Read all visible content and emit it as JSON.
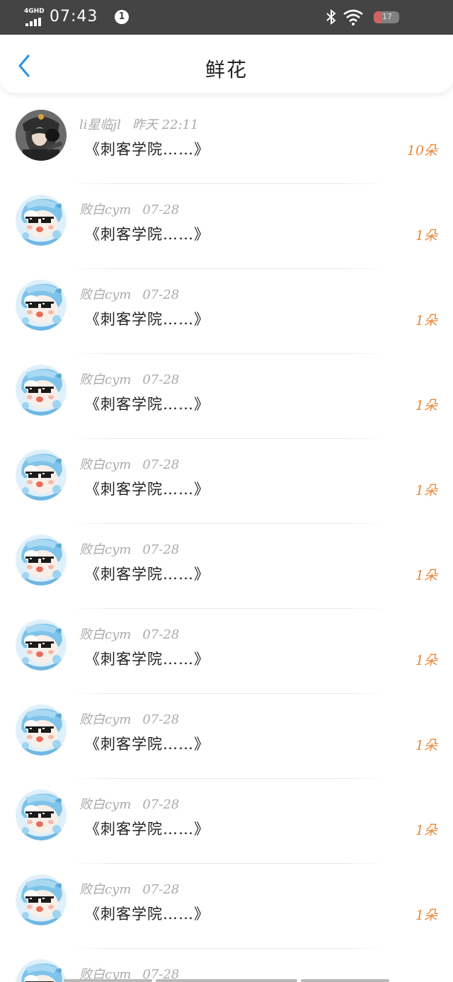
{
  "status_bar": {
    "network": "4GHD",
    "time": "07:43",
    "notification_count": "1",
    "battery_text": "17"
  },
  "header": {
    "title": "鲜花"
  },
  "items": [
    {
      "name": "li星临jl",
      "date": "昨天 22:11",
      "message": "《刺客学院……》",
      "count": "10朵",
      "avatar": "dark-character-avatar"
    },
    {
      "name": "败白cym",
      "date": "07-28",
      "message": "《刺客学院……》",
      "count": "1朵",
      "avatar": "cartoon-sunglasses-avatar"
    },
    {
      "name": "败白cym",
      "date": "07-28",
      "message": "《刺客学院……》",
      "count": "1朵",
      "avatar": "cartoon-sunglasses-avatar"
    },
    {
      "name": "败白cym",
      "date": "07-28",
      "message": "《刺客学院……》",
      "count": "1朵",
      "avatar": "cartoon-sunglasses-avatar"
    },
    {
      "name": "败白cym",
      "date": "07-28",
      "message": "《刺客学院……》",
      "count": "1朵",
      "avatar": "cartoon-sunglasses-avatar"
    },
    {
      "name": "败白cym",
      "date": "07-28",
      "message": "《刺客学院……》",
      "count": "1朵",
      "avatar": "cartoon-sunglasses-avatar"
    },
    {
      "name": "败白cym",
      "date": "07-28",
      "message": "《刺客学院……》",
      "count": "1朵",
      "avatar": "cartoon-sunglasses-avatar"
    },
    {
      "name": "败白cym",
      "date": "07-28",
      "message": "《刺客学院……》",
      "count": "1朵",
      "avatar": "cartoon-sunglasses-avatar"
    },
    {
      "name": "败白cym",
      "date": "07-28",
      "message": "《刺客学院……》",
      "count": "1朵",
      "avatar": "cartoon-sunglasses-avatar"
    },
    {
      "name": "败白cym",
      "date": "07-28",
      "message": "《刺客学院……》",
      "count": "1朵",
      "avatar": "cartoon-sunglasses-avatar"
    },
    {
      "name": "败白cym",
      "date": "07-28",
      "message": "",
      "count": "",
      "avatar": "cartoon-sunglasses-avatar"
    }
  ],
  "colors": {
    "status_bar_bg": "#444444",
    "accent_blue": "#2d95e8",
    "count_orange": "#e8893d",
    "meta_gray": "#aaaaaa"
  }
}
